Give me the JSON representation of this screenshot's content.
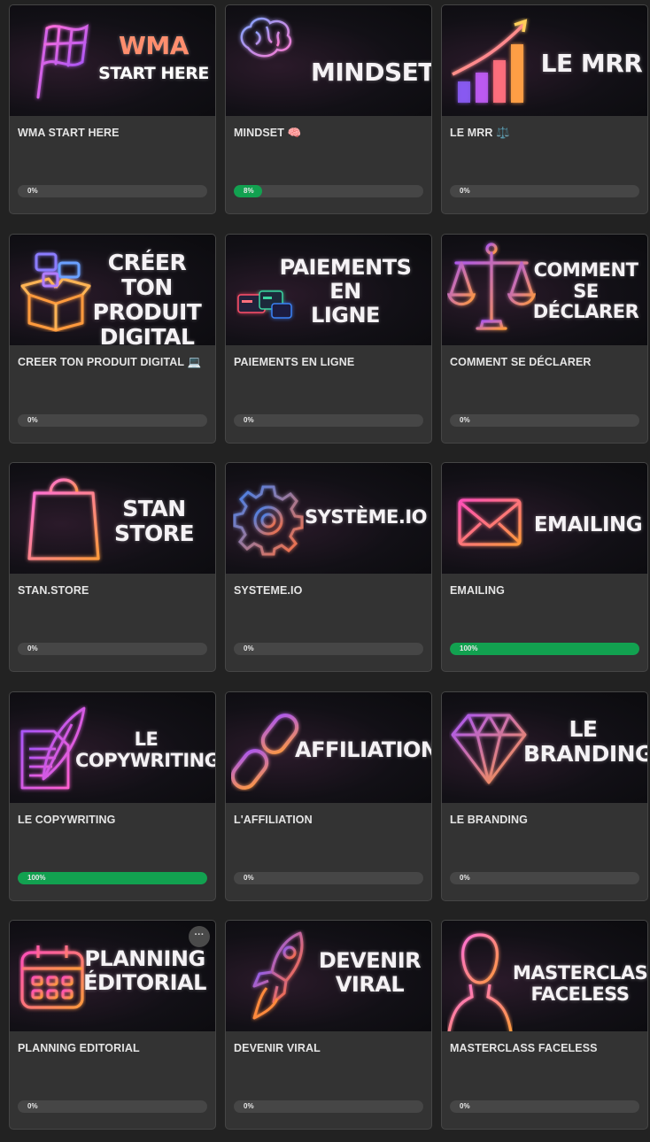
{
  "courses": [
    {
      "title": "WMA START HERE",
      "thumb_text": "",
      "thumb_lines": [
        "WMA",
        "START HERE"
      ],
      "progress": 0,
      "progress_label": "0%",
      "icon": "flag-icon"
    },
    {
      "title": "MINDSET 🧠",
      "thumb_lines": [
        "MINDSET"
      ],
      "progress": 0.08,
      "progress_label": "8%",
      "icon": "brain-icon"
    },
    {
      "title": "LE MRR ⚖️",
      "thumb_lines": [
        "LE MRR"
      ],
      "progress": 0,
      "progress_label": "0%",
      "icon": "growth-chart-icon"
    },
    {
      "title": "CREER TON PRODUIT DIGITAL 💻",
      "thumb_lines": [
        "CRÉER TON",
        "PRODUIT",
        "DIGITAL"
      ],
      "progress": 0,
      "progress_label": "0%",
      "icon": "box-icon"
    },
    {
      "title": "PAIEMENTS EN LIGNE",
      "thumb_lines": [
        "PAIEMENTS EN",
        "LIGNE"
      ],
      "progress": 0,
      "progress_label": "0%",
      "icon": "payment-cards-icon"
    },
    {
      "title": "COMMENT SE DÉCLARER",
      "thumb_lines": [
        "COMMENT",
        "SE",
        "DÉCLARER"
      ],
      "progress": 0,
      "progress_label": "0%",
      "icon": "scales-icon"
    },
    {
      "title": "STAN.STORE",
      "thumb_lines": [
        "STAN",
        "STORE"
      ],
      "progress": 0,
      "progress_label": "0%",
      "icon": "shopping-bag-icon"
    },
    {
      "title": "SYSTEME.IO",
      "thumb_lines": [
        "SYSTÈME.IO"
      ],
      "progress": 0,
      "progress_label": "0%",
      "icon": "gear-icon"
    },
    {
      "title": "EMAILING",
      "thumb_lines": [
        "EMAILING"
      ],
      "progress": 1,
      "progress_label": "100%",
      "icon": "envelope-icon"
    },
    {
      "title": "LE COPYWRITING",
      "thumb_lines": [
        "LE",
        "COPYWRITING"
      ],
      "progress": 1,
      "progress_label": "100%",
      "icon": "quill-icon"
    },
    {
      "title": "L'AFFILIATION",
      "thumb_lines": [
        "AFFILIATION"
      ],
      "progress": 0,
      "progress_label": "0%",
      "icon": "chain-link-icon"
    },
    {
      "title": "LE BRANDING",
      "thumb_lines": [
        "LE",
        "BRANDING"
      ],
      "progress": 0,
      "progress_label": "0%",
      "icon": "diamond-icon"
    },
    {
      "title": "PLANNING EDITORIAL",
      "thumb_lines": [
        "PLANNING",
        "ÉDITORIAL"
      ],
      "progress": 0,
      "progress_label": "0%",
      "icon": "calendar-icon",
      "has_menu": true,
      "menu_label": "···"
    },
    {
      "title": "DEVENIR VIRAL",
      "thumb_lines": [
        "DEVENIR",
        "VIRAL"
      ],
      "progress": 0,
      "progress_label": "0%",
      "icon": "rocket-icon"
    },
    {
      "title": "MASTERCLASS FACELESS",
      "thumb_lines": [
        "MASTERCLASS",
        "FACELESS"
      ],
      "progress": 0,
      "progress_label": "0%",
      "icon": "faceless-person-icon"
    }
  ],
  "colors": {
    "background": "#222222",
    "card": "#333333",
    "progress_track": "#464646",
    "progress_fill": "#12a150",
    "neon_pink": "#ff4fb8",
    "neon_orange": "#ff8a3c",
    "neon_purple": "#a855f7",
    "neon_blue": "#3b82f6"
  }
}
